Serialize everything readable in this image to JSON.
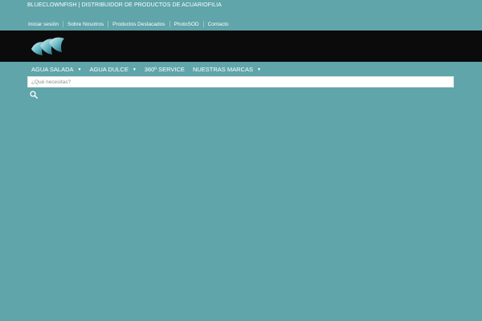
{
  "tagline": "BLUECLOWNFISH | DISTRIBUIDOR DE PRODUCTOS DE ACUARIOFILIA",
  "top_nav": [
    {
      "label": "Iniciar sesión"
    },
    {
      "label": "Sobre Nosotros"
    },
    {
      "label": "Productos Destacados"
    },
    {
      "label": "PhotoSOD"
    },
    {
      "label": "Contacto"
    }
  ],
  "main_nav": [
    {
      "label": "AGUA SALADA",
      "has_dropdown": true
    },
    {
      "label": "AGUA DULCE",
      "has_dropdown": true
    },
    {
      "label": "360º SERVICE",
      "has_dropdown": false
    },
    {
      "label": "NUESTRAS MARCAS",
      "has_dropdown": true
    }
  ],
  "search": {
    "placeholder": "¿Qué necesitas?",
    "value": ""
  },
  "colors": {
    "page_bg": "#5fa5aa",
    "header_bg": "#0b0b0b",
    "text": "#ffffff"
  },
  "icons": {
    "logo": "fish-logo-icon",
    "search": "search-icon",
    "dropdown": "caret-down-icon"
  }
}
